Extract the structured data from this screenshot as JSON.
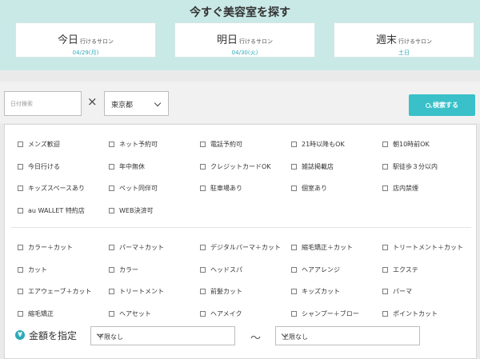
{
  "header": {
    "title": "今すぐ美容室を探す",
    "days": [
      {
        "big": "今日",
        "small": "行けるサロン",
        "date": "04/29(月)"
      },
      {
        "big": "明日",
        "small": "行けるサロン",
        "date": "04/30(火)"
      },
      {
        "big": "週末",
        "small": "行けるサロン",
        "date": "土日"
      }
    ]
  },
  "search": {
    "date_placeholder": "日付検索",
    "times": "×",
    "prefecture": "東京都",
    "button_label": "検索する"
  },
  "conditions": [
    "メンズ歓迎",
    "ネット予約可",
    "電話予約可",
    "21時以降もOK",
    "朝10時前OK",
    "今日行ける",
    "年中無休",
    "クレジットカードOK",
    "雑誌掲載店",
    "駅徒歩３分以内",
    "キッズスペースあり",
    "ペット同伴可",
    "駐車場あり",
    "個室あり",
    "店内禁煙",
    "au WALLET 特約店",
    "WEB決済可"
  ],
  "menus": [
    "カラー＋カット",
    "パーマ＋カット",
    "デジタルパーマ＋カット",
    "縮毛矯正＋カット",
    "トリートメント＋カット",
    "カット",
    "カラー",
    "ヘッドスパ",
    "ヘアアレンジ",
    "エクステ",
    "エアウェーブ＋カット",
    "トリートメント",
    "前髪カット",
    "キッズカット",
    "パーマ",
    "縮毛矯正",
    "ヘアセット",
    "ヘアメイク",
    "シャンプー＋ブロー",
    "ポイントカット"
  ],
  "price": {
    "icon": "¥",
    "label": "金額を指定",
    "min_value": "下限なし",
    "separator": "〜",
    "max_value": "上限なし"
  }
}
